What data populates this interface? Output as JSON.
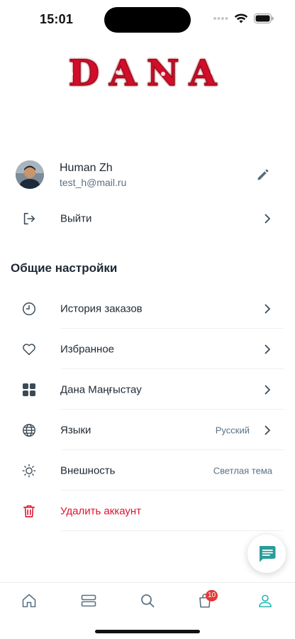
{
  "status_bar": {
    "time": "15:01"
  },
  "brand": {
    "logo_text": "DANA",
    "logo_color": "#d2102a"
  },
  "profile": {
    "name": "Human Zh",
    "email": "test_h@mail.ru"
  },
  "logout": {
    "label": "Выйти"
  },
  "general_settings": {
    "title": "Общие настройки",
    "items": [
      {
        "label": "История заказов",
        "icon": "clock-icon",
        "chevron": true
      },
      {
        "label": "Избранное",
        "icon": "heart-icon",
        "chevron": true
      },
      {
        "label": "Дана Маңғыстау",
        "icon": "grid-icon",
        "chevron": true
      },
      {
        "label": "Языки",
        "value": "Русский",
        "icon": "globe-icon",
        "chevron": true
      },
      {
        "label": "Внешность",
        "value": "Светлая тема",
        "icon": "sun-icon",
        "chevron": false
      },
      {
        "label": "Удалить аккаунт",
        "icon": "trash-icon",
        "chevron": false,
        "danger_color": "#e0112b"
      }
    ]
  },
  "tab_bar": {
    "tabs": [
      "home-icon",
      "catalog-icon",
      "search-icon",
      "cart-icon",
      "profile-icon"
    ],
    "cart_badge": "10",
    "active_color": "#26b5b0",
    "inactive_color": "#5a7184"
  }
}
